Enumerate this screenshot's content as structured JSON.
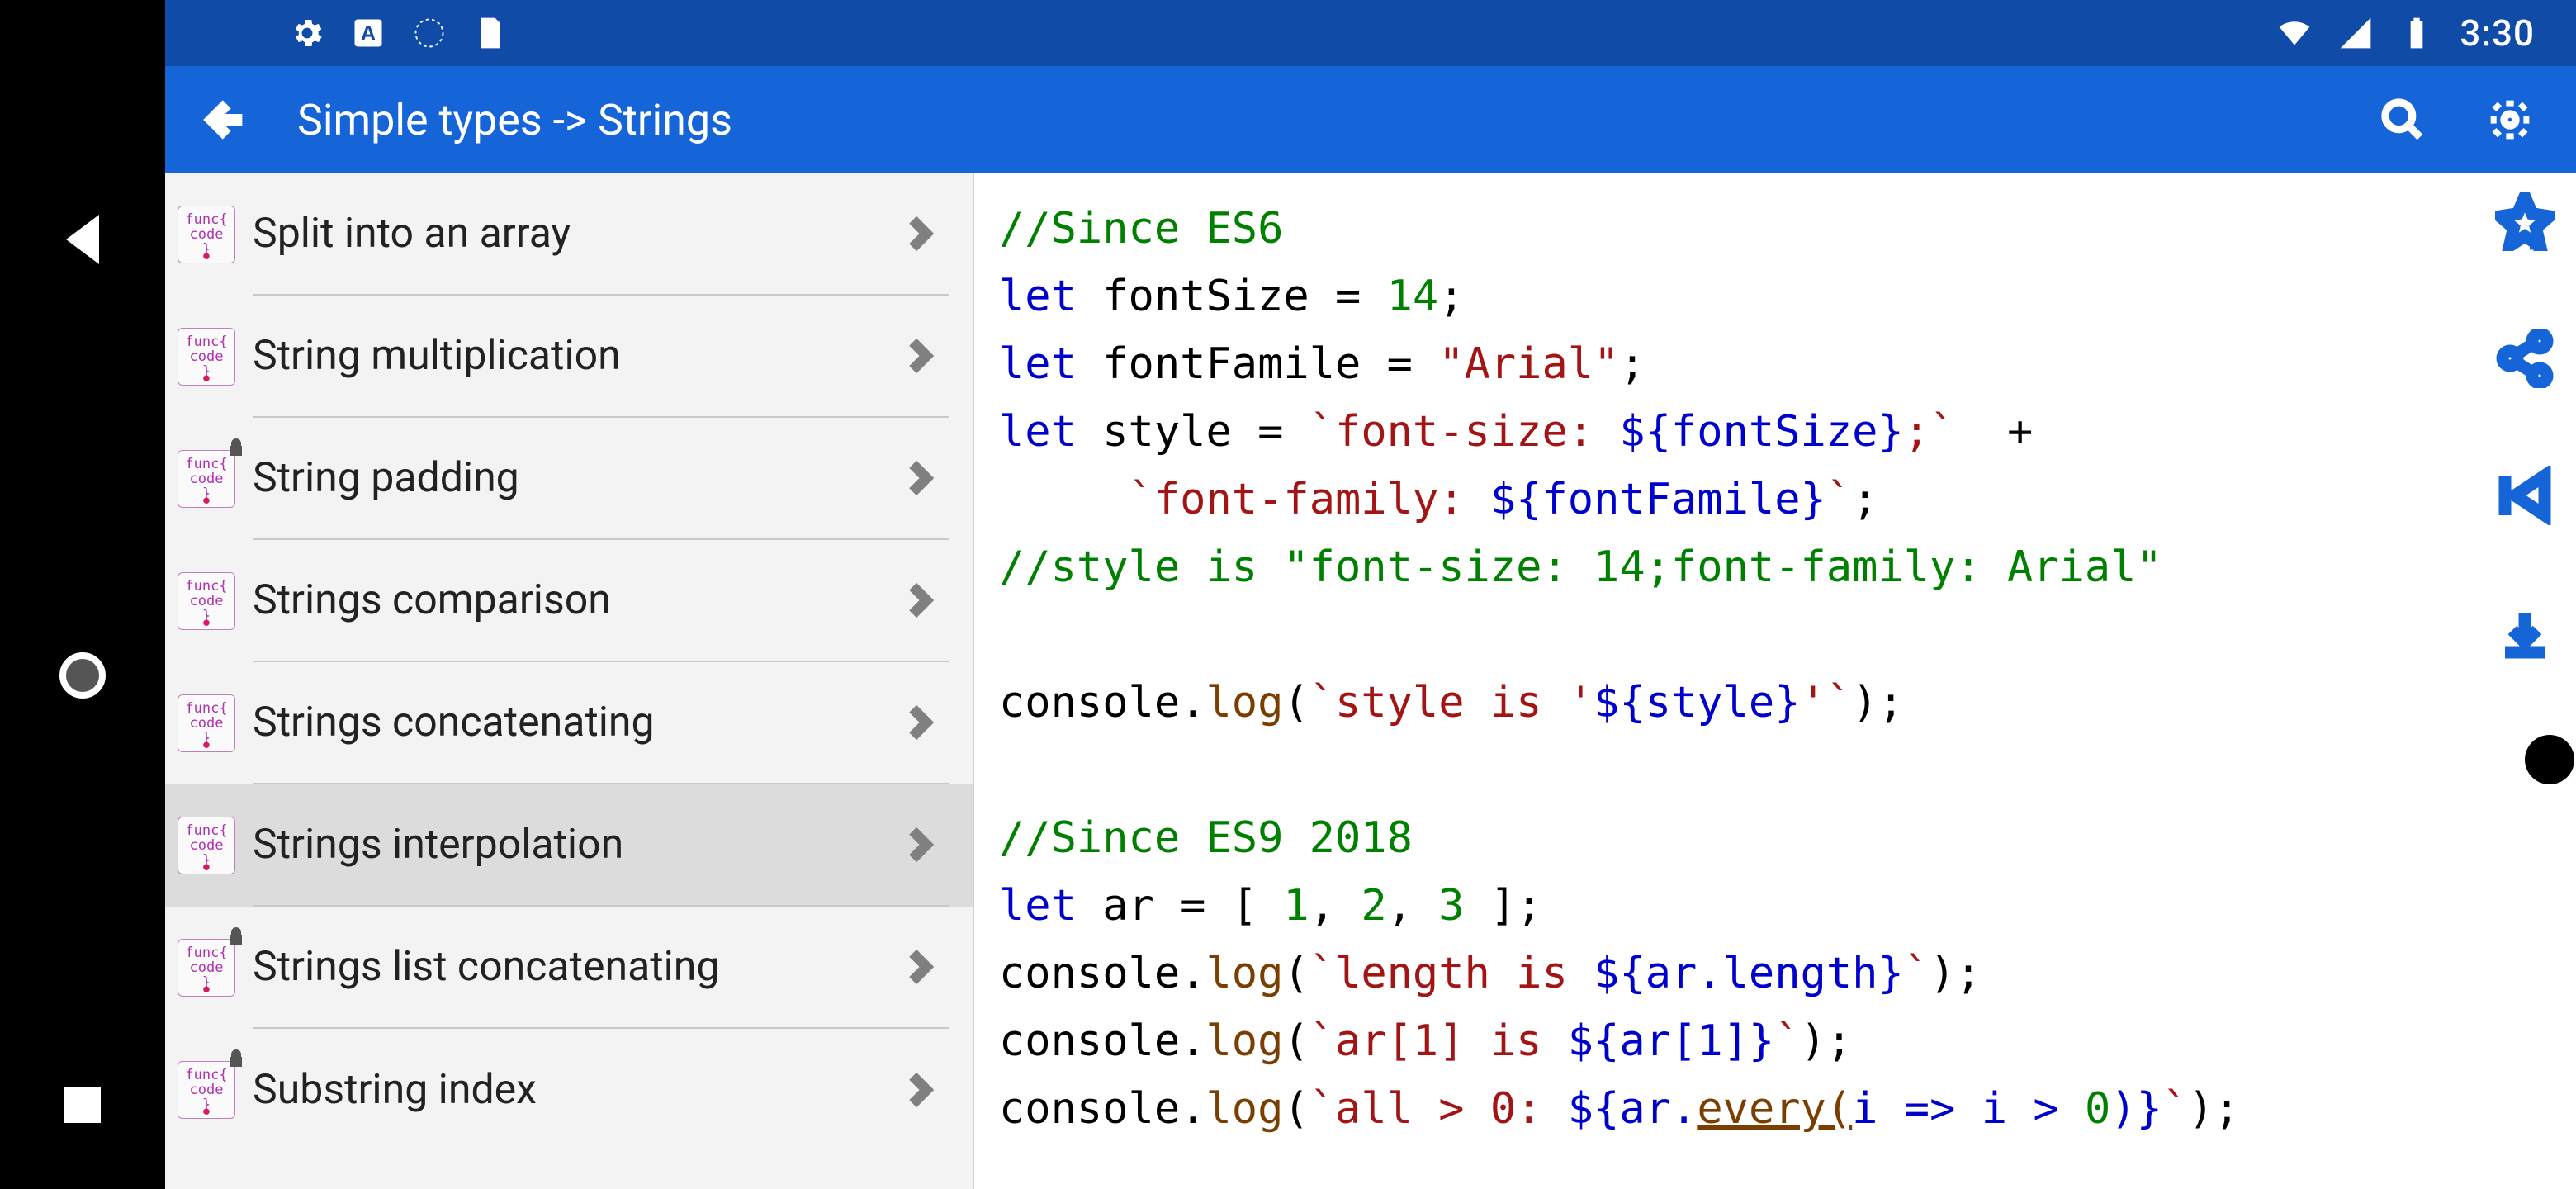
{
  "statusbar": {
    "clock": "3:30"
  },
  "appbar": {
    "title": "Simple types -> Strings"
  },
  "sidebar": {
    "items": [
      {
        "label": "Split into an array",
        "locked": false,
        "selected": false
      },
      {
        "label": "String multiplication",
        "locked": false,
        "selected": false
      },
      {
        "label": "String padding",
        "locked": true,
        "selected": false
      },
      {
        "label": "Strings comparison",
        "locked": false,
        "selected": false
      },
      {
        "label": "Strings concatenating",
        "locked": false,
        "selected": false
      },
      {
        "label": "Strings interpolation",
        "locked": false,
        "selected": true
      },
      {
        "label": "Strings list concatenating",
        "locked": true,
        "selected": false
      },
      {
        "label": "Substring index",
        "locked": true,
        "selected": false
      }
    ]
  },
  "code": {
    "c1": "//Since ES6",
    "kw": "let",
    "v1": "fontSize",
    "eq": " = ",
    "n14": "14",
    "semi": ";",
    "v2": "fontFamile",
    "s_arial": "\"Arial\"",
    "v3": "style",
    "t1a": "`font-size: ",
    "i1": "${fontSize}",
    "t1b": ";`",
    "plus": "  +",
    "t2a": "`font-family: ",
    "i2": "${fontFamile}",
    "t2b": "`",
    "c2": "//style is \"font-size: 14;font-family: Arial\"",
    "con": "console",
    "dot": ".",
    "log": "log",
    "lp": "(",
    "rp": ")",
    "t3a": "`style is '",
    "i3": "${style}",
    "t3b": "'`",
    "c3": "//Since ES9 2018",
    "v4": "ar",
    "arr_open": " = [ ",
    "n1": "1",
    "cm": ", ",
    "n2": "2",
    "n3": "3",
    "arr_close": " ];",
    "t4a": "`length is ",
    "i4": "${ar.length}",
    "t4b": "`",
    "t5a": "`ar[1] is ",
    "i5": "${ar[1]}",
    "t5b": "`",
    "t6a": "`all > 0: ",
    "i6a": "${ar.",
    "every": "every(",
    "i6b": "i ",
    "arrow": "=>",
    "i6c": " i > ",
    "n0": "0",
    "i6d": ")}",
    "t6b": "`"
  }
}
